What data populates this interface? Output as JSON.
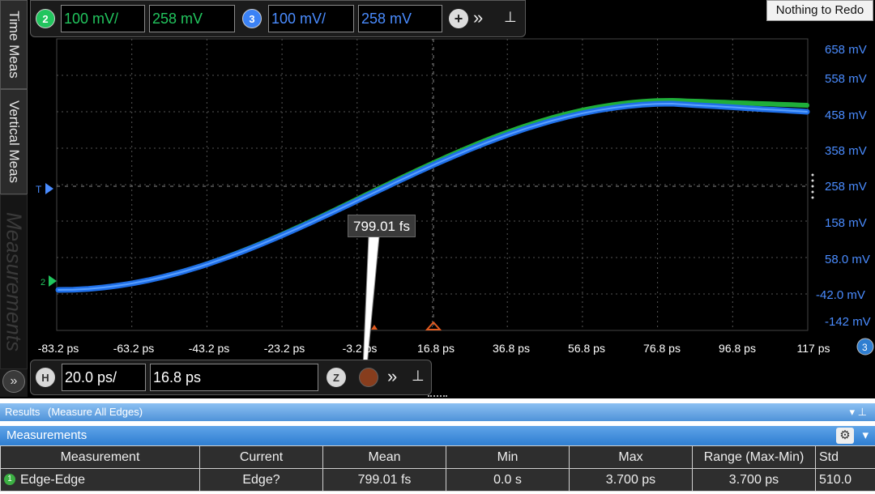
{
  "side_tabs": [
    "Time Meas",
    "Vertical Meas",
    "Measurements"
  ],
  "top_toolbar": {
    "ch2": {
      "badge": "2",
      "scale": "100 mV/",
      "offset": "258 mV",
      "color": "#22c55e"
    },
    "ch3": {
      "badge": "3",
      "scale": "100 mV/",
      "offset": "258 mV",
      "color": "#3b82f6"
    },
    "add_icon": "plus-circle-icon",
    "more_icon": "double-chevron-right-icon",
    "pin_icon": "pin-icon"
  },
  "redo_label": "Nothing to Redo",
  "y_axis": {
    "labels": [
      "658 mV",
      "558 mV",
      "458 mV",
      "358 mV",
      "258 mV",
      "158 mV",
      "58.0 mV",
      "-42.0 mV",
      "-142 mV"
    ],
    "color": "#4a8cff"
  },
  "x_axis": {
    "labels": [
      "-83.2 ps",
      "-63.2 ps",
      "-43.2 ps",
      "-23.2 ps",
      "-3.2 ps",
      "16.8 ps",
      "36.8 ps",
      "56.8 ps",
      "76.8 ps",
      "96.8 ps",
      "117 ps"
    ]
  },
  "markers": {
    "trigger": "T",
    "ground_ch2": "2",
    "ch3_badge": "3"
  },
  "tooltip": "799.01 fs",
  "horizontal": {
    "badge": "H",
    "scale": "20.0 ps/",
    "position": "16.8 ps",
    "zoom_label": "Z"
  },
  "results": {
    "title": "Results",
    "subtitle": "(Measure All Edges)",
    "section": "Measurements",
    "columns": [
      "Measurement",
      "Current",
      "Mean",
      "Min",
      "Max",
      "Range (Max-Min)",
      "Std"
    ],
    "rows": [
      {
        "source": "1",
        "name": "Edge-Edge",
        "current": "Edge?",
        "mean": "799.01 fs",
        "min": "0.0 s",
        "max": "3.700 ps",
        "range": "3.700 ps",
        "std": "510.0"
      }
    ]
  }
}
